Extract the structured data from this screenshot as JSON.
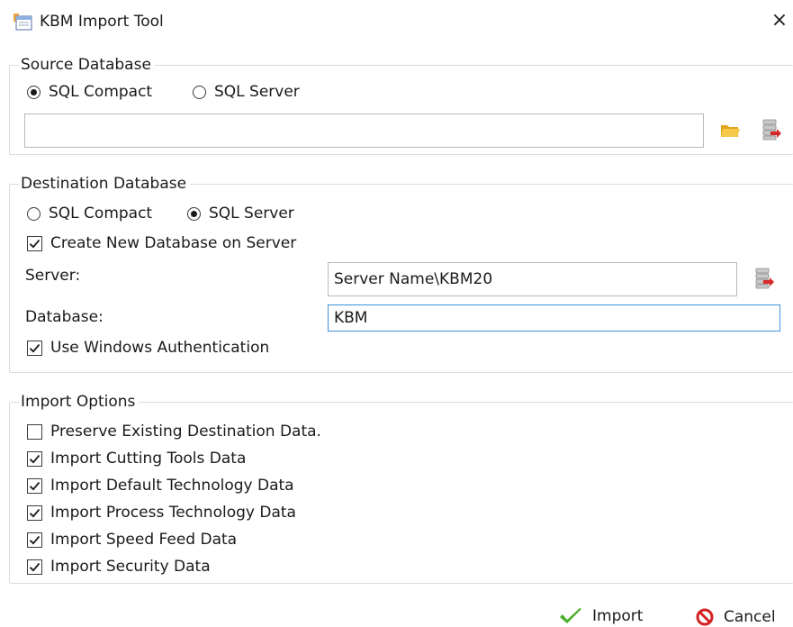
{
  "window": {
    "title": "KBM Import Tool",
    "close_glyph": "×"
  },
  "source": {
    "legend": "Source Database",
    "radio_compact": "SQL Compact",
    "radio_server": "SQL Server",
    "selected": "SQL Compact",
    "path_value": "",
    "icons": [
      "open-folder-icon",
      "database-connect-icon"
    ]
  },
  "destination": {
    "legend": "Destination Database",
    "radio_compact": "SQL Compact",
    "radio_server": "SQL Server",
    "selected": "SQL Server",
    "create_new_label": "Create New Database on Server",
    "create_new_checked": true,
    "server_label": "Server:",
    "server_value": "Server Name\\KBM20",
    "database_label": "Database:",
    "database_value": "KBM",
    "windows_auth_label": "Use Windows Authentication",
    "windows_auth_checked": true,
    "icons": [
      "database-connect-icon"
    ]
  },
  "import_options": {
    "legend": "Import Options",
    "items": [
      {
        "label": "Preserve Existing Destination Data.",
        "checked": false
      },
      {
        "label": "Import Cutting Tools Data",
        "checked": true
      },
      {
        "label": "Import Default Technology Data",
        "checked": true
      },
      {
        "label": "Import Process Technology Data",
        "checked": true
      },
      {
        "label": "Import Speed Feed Data",
        "checked": true
      },
      {
        "label": "Import Security Data",
        "checked": true
      }
    ]
  },
  "buttons": {
    "import_label": "Import",
    "cancel_label": "Cancel"
  },
  "colors": {
    "import_check": "#4caf2a",
    "cancel_red": "#d32020",
    "focus_border": "#3f8fd8",
    "folder_yellow": "#f2c230"
  }
}
